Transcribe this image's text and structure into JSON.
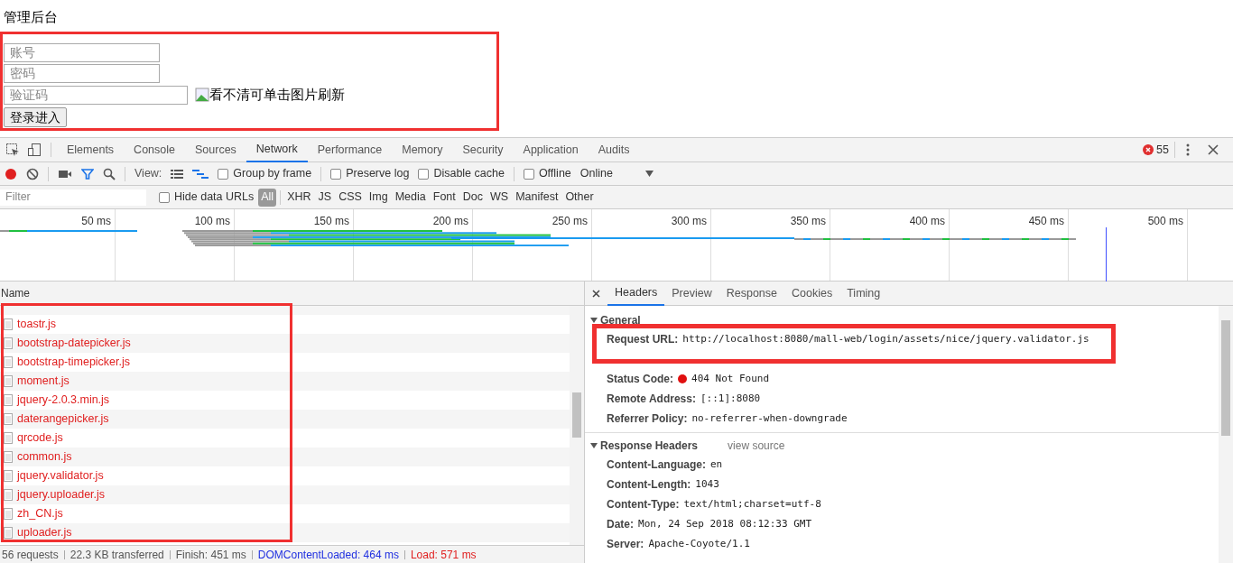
{
  "page": {
    "heading": "管理后台",
    "fields": [
      {
        "placeholder": "账号",
        "wide": false
      },
      {
        "placeholder": "密码",
        "wide": false
      },
      {
        "placeholder": "验证码",
        "wide": true
      }
    ],
    "captcha_alt": "看不清可单击图片刷新",
    "submit": "登录进入"
  },
  "devtools": {
    "tabs": [
      {
        "label": "Elements",
        "selected": false
      },
      {
        "label": "Console",
        "selected": false
      },
      {
        "label": "Sources",
        "selected": false
      },
      {
        "label": "Network",
        "selected": true
      },
      {
        "label": "Performance",
        "selected": false
      },
      {
        "label": "Memory",
        "selected": false
      },
      {
        "label": "Security",
        "selected": false
      },
      {
        "label": "Application",
        "selected": false
      },
      {
        "label": "Audits",
        "selected": false
      }
    ],
    "error_count": "55",
    "toolbar": {
      "recording": true,
      "view_label": "View:",
      "options": [
        {
          "label": "Group by frame",
          "checked": false
        },
        {
          "label": "Preserve log",
          "checked": false
        },
        {
          "label": "Disable cache",
          "checked": false
        },
        {
          "label": "Offline",
          "checked": false
        }
      ],
      "throttle": "Online"
    },
    "filter": {
      "placeholder": "Filter",
      "hide_data_urls": {
        "label": "Hide data URLs",
        "checked": false
      },
      "types": [
        {
          "label": "All",
          "selected": true
        },
        {
          "label": "XHR",
          "selected": false
        },
        {
          "label": "JS",
          "selected": false
        },
        {
          "label": "CSS",
          "selected": false
        },
        {
          "label": "Img",
          "selected": false
        },
        {
          "label": "Media",
          "selected": false
        },
        {
          "label": "Font",
          "selected": false
        },
        {
          "label": "Doc",
          "selected": false
        },
        {
          "label": "WS",
          "selected": false
        },
        {
          "label": "Manifest",
          "selected": false
        },
        {
          "label": "Other",
          "selected": false
        }
      ]
    },
    "overview": {
      "ticks": [
        "50 ms",
        "100 ms",
        "150 ms",
        "200 ms",
        "250 ms",
        "300 ms",
        "350 ms",
        "400 ms",
        "450 ms",
        "500 ms"
      ]
    },
    "requests": {
      "column": "Name",
      "rows": [
        {
          "name": "toastr.js",
          "failed": true
        },
        {
          "name": "bootstrap-datepicker.js",
          "failed": true
        },
        {
          "name": "bootstrap-timepicker.js",
          "failed": true
        },
        {
          "name": "moment.js",
          "failed": true
        },
        {
          "name": "jquery-2.0.3.min.js",
          "failed": true
        },
        {
          "name": "daterangepicker.js",
          "failed": true
        },
        {
          "name": "qrcode.js",
          "failed": true
        },
        {
          "name": "common.js",
          "failed": true
        },
        {
          "name": "jquery.validator.js",
          "failed": true
        },
        {
          "name": "jquery.uploader.js",
          "failed": true
        },
        {
          "name": "zh_CN.js",
          "failed": true
        },
        {
          "name": "uploader.js",
          "failed": true
        }
      ]
    },
    "detail": {
      "tabs": [
        {
          "label": "Headers",
          "selected": true
        },
        {
          "label": "Preview",
          "selected": false
        },
        {
          "label": "Response",
          "selected": false
        },
        {
          "label": "Cookies",
          "selected": false
        },
        {
          "label": "Timing",
          "selected": false
        }
      ],
      "sections": [
        {
          "title": "General",
          "expanded": true,
          "items": [
            {
              "kind": "plain",
              "key": "Request URL:",
              "value": "http://localhost:8080/mall-web/login/assets/nice/jquery.validator.js"
            },
            {
              "kind": "hidden"
            },
            {
              "kind": "status",
              "key": "Status Code:",
              "value": "404 Not Found"
            },
            {
              "kind": "plain",
              "key": "Remote Address:",
              "value": "[::1]:8080"
            },
            {
              "kind": "plain",
              "key": "Referrer Policy:",
              "value": "no-referrer-when-downgrade"
            }
          ]
        },
        {
          "title": "Response Headers",
          "expanded": true,
          "link": "view source",
          "items": [
            {
              "kind": "plain",
              "key": "Content-Language:",
              "value": "en"
            },
            {
              "kind": "plain",
              "key": "Content-Length:",
              "value": "1043"
            },
            {
              "kind": "plain",
              "key": "Content-Type:",
              "value": "text/html;charset=utf-8"
            },
            {
              "kind": "plain",
              "key": "Date:",
              "value": "Mon, 24 Sep 2018 08:12:33 GMT"
            },
            {
              "kind": "plain",
              "key": "Server:",
              "value": "Apache-Coyote/1.1"
            }
          ]
        }
      ]
    },
    "status_bar": [
      {
        "text": "56 requests",
        "kind": "plain"
      },
      {
        "text": "22.3 KB transferred",
        "kind": "plain"
      },
      {
        "text": "Finish: 451 ms",
        "kind": "plain"
      },
      {
        "text": "DOMContentLoaded: 464 ms",
        "kind": "dom"
      },
      {
        "text": "Load: 571 ms",
        "kind": "load"
      }
    ]
  }
}
